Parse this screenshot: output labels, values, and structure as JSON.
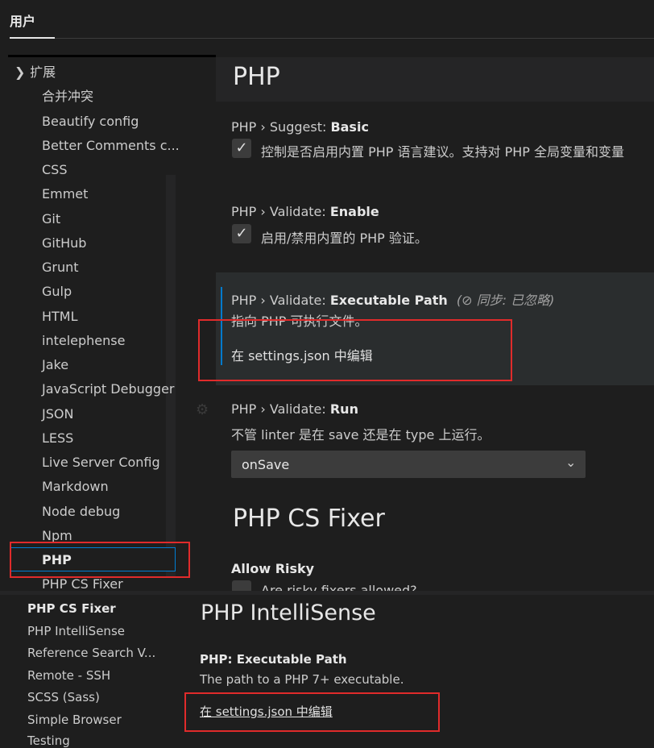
{
  "tabs": {
    "user": "用户"
  },
  "nav": {
    "extensions_label": "扩展",
    "items": [
      "合并冲突",
      "Beautify config",
      "Better Comments c...",
      "CSS",
      "Emmet",
      "Git",
      "GitHub",
      "Grunt",
      "Gulp",
      "HTML",
      "intelephense",
      "Jake",
      "JavaScript Debugger",
      "JSON",
      "LESS",
      "Live Server Config",
      "Markdown",
      "Node debug",
      "Npm",
      "PHP",
      "PHP CS Fixer"
    ],
    "selected": "PHP"
  },
  "main": {
    "section_php": "PHP",
    "suggest": {
      "prefix": "PHP › Suggest: ",
      "name": "Basic",
      "checked": true,
      "desc": "控制是否启用内置 PHP 语言建议。支持对 PHP 全局变量和变量"
    },
    "validate_enable": {
      "prefix": "PHP › Validate: ",
      "name": "Enable",
      "checked": true,
      "desc": "启用/禁用内置的 PHP 验证。"
    },
    "validate_path": {
      "prefix": "PHP › Validate: ",
      "name": "Executable Path",
      "sync_note": "同步: 已忽略",
      "desc": "指向 PHP 可执行文件。",
      "link": "在 settings.json 中编辑"
    },
    "validate_run": {
      "prefix": "PHP › Validate: ",
      "name": "Run",
      "desc": "不管 linter 是在 save 还是在 type 上运行。",
      "value": "onSave"
    },
    "section_phpcs": "PHP CS Fixer",
    "allow_risky": {
      "name": "Allow Risky",
      "desc": "Are risky fixers allowed?"
    }
  },
  "bottom": {
    "nav_items": [
      "PHP CS Fixer",
      "PHP IntelliSense",
      "Reference Search V...",
      "Remote - SSH",
      "SCSS (Sass)",
      "Simple Browser",
      "Testing"
    ],
    "section": "PHP IntelliSense",
    "setting": {
      "name": "PHP: Executable Path",
      "desc": "The path to a PHP 7+ executable.",
      "link": "在 settings.json 中编辑"
    }
  }
}
